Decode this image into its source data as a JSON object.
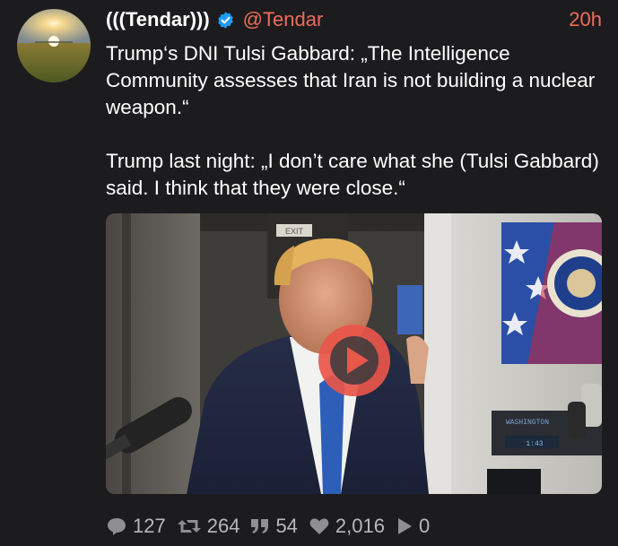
{
  "tweet": {
    "display_name": "(((Tendar)))",
    "handle": "@Tendar",
    "timestamp": "20h",
    "paragraphs": [
      "Trump‘s DNI Tulsi Gabbard: „The Intelligence Community assesses that Iran is not building a nuclear weapon.“",
      "Trump last night: „I don’t care what she (Tulsi Gabbard) said. I think that they were close.“"
    ],
    "media": {
      "type": "video",
      "sign_exit": "EXIT",
      "sign_washington": "WASHINGTON",
      "sign_display": "1:43"
    }
  },
  "actions": {
    "replies": "127",
    "retweets": "264",
    "quotes": "54",
    "likes": "2,016",
    "views": "0"
  },
  "colors": {
    "accent": "#f06c5b",
    "verified": "#1d9bf0",
    "background": "#1c1c1e",
    "icon_gray": "#8e8e93"
  },
  "icons": [
    "verified-badge-icon",
    "play-icon",
    "reply-icon",
    "retweet-icon",
    "quote-icon",
    "heart-icon",
    "views-icon"
  ]
}
